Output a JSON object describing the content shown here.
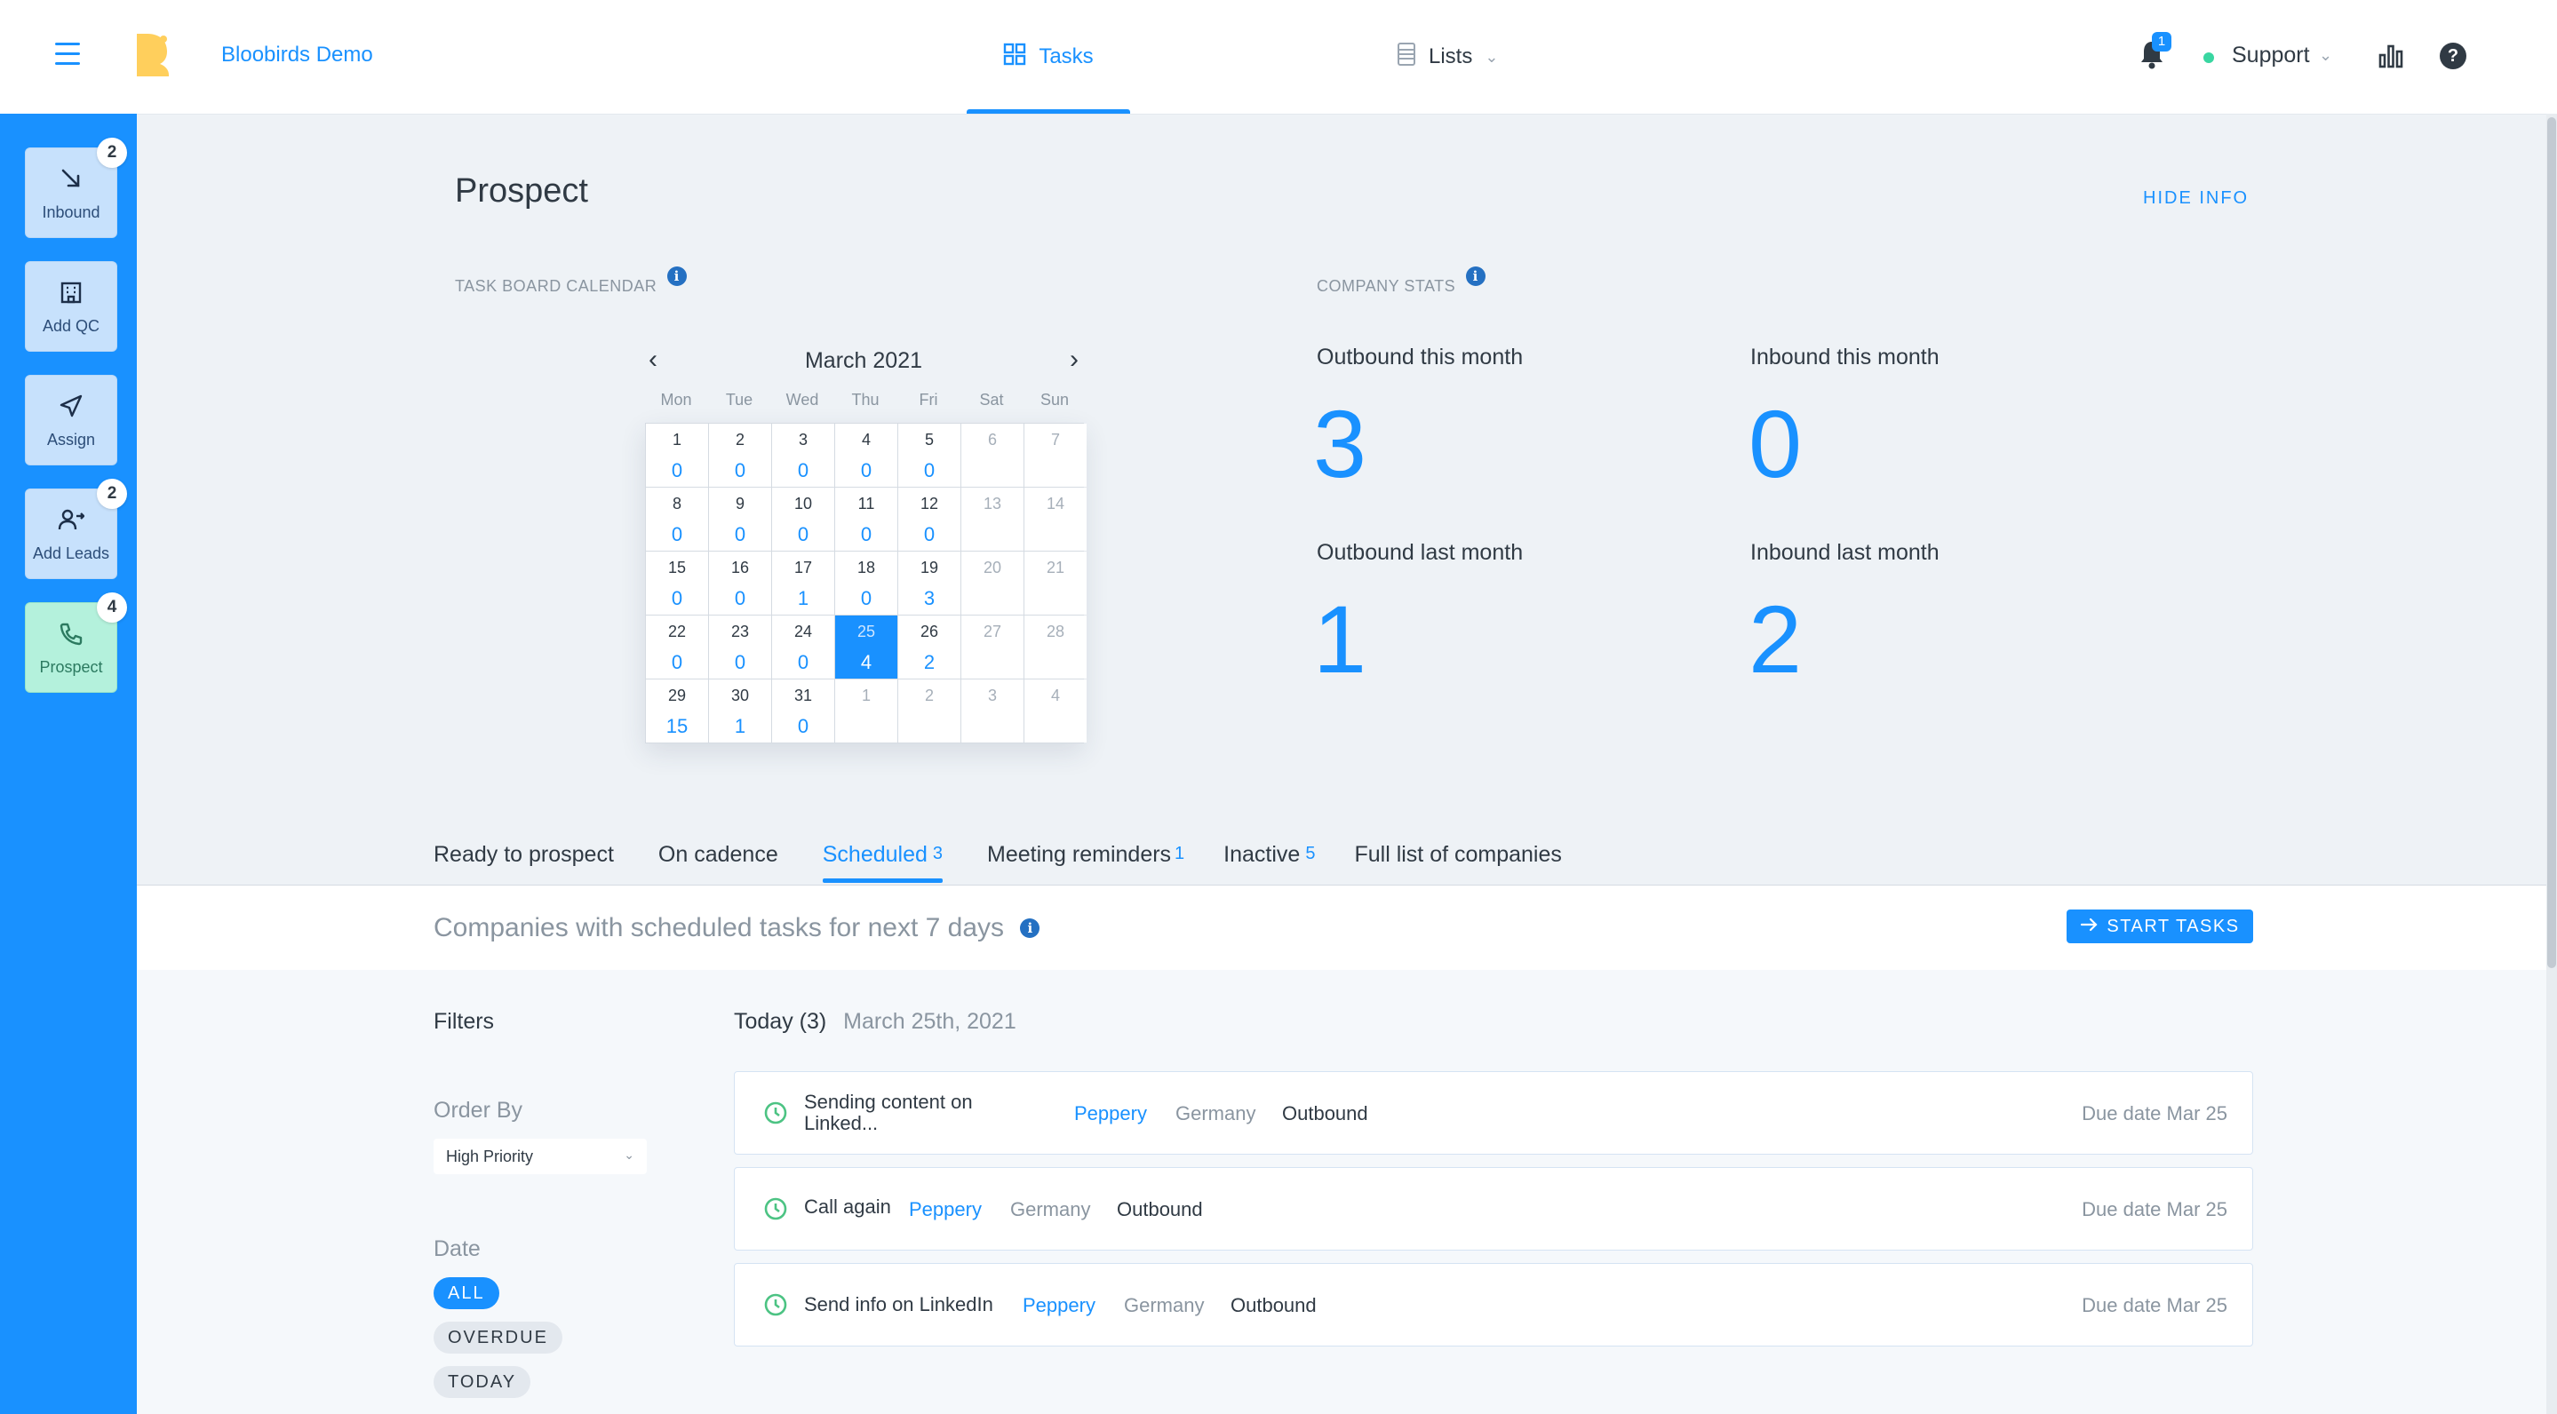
{
  "header": {
    "brand": "Bloobirds Demo",
    "nav": [
      {
        "label": "Tasks",
        "icon": "grid-icon",
        "active": true
      },
      {
        "label": "Lists",
        "icon": "list-icon",
        "active": false
      }
    ],
    "notification_count": "1",
    "user": "Support",
    "accent_color": "#1991ff"
  },
  "sidebar": {
    "items": [
      {
        "label": "Inbound",
        "icon": "arrow-down-right-icon",
        "badge": "2"
      },
      {
        "label": "Add QC",
        "icon": "building-icon",
        "badge": ""
      },
      {
        "label": "Assign",
        "icon": "send-icon",
        "badge": ""
      },
      {
        "label": "Add Leads",
        "icon": "add-user-icon",
        "badge": "2"
      },
      {
        "label": "Prospect",
        "icon": "phone-icon",
        "badge": "4",
        "active": true
      }
    ]
  },
  "page": {
    "title": "Prospect",
    "hide_info": "HIDE INFO"
  },
  "calendar": {
    "label": "TASK BOARD CALENDAR",
    "month": "March 2021",
    "weekdays": [
      "Mon",
      "Tue",
      "Wed",
      "Thu",
      "Fri",
      "Sat",
      "Sun"
    ],
    "weeks": [
      [
        {
          "d": "1",
          "c": "0"
        },
        {
          "d": "2",
          "c": "0"
        },
        {
          "d": "3",
          "c": "0"
        },
        {
          "d": "4",
          "c": "0"
        },
        {
          "d": "5",
          "c": "0"
        },
        {
          "d": "6",
          "c": "",
          "m": true
        },
        {
          "d": "7",
          "c": "",
          "m": true
        }
      ],
      [
        {
          "d": "8",
          "c": "0"
        },
        {
          "d": "9",
          "c": "0"
        },
        {
          "d": "10",
          "c": "0"
        },
        {
          "d": "11",
          "c": "0"
        },
        {
          "d": "12",
          "c": "0"
        },
        {
          "d": "13",
          "c": "",
          "m": true
        },
        {
          "d": "14",
          "c": "",
          "m": true
        }
      ],
      [
        {
          "d": "15",
          "c": "0"
        },
        {
          "d": "16",
          "c": "0"
        },
        {
          "d": "17",
          "c": "1"
        },
        {
          "d": "18",
          "c": "0"
        },
        {
          "d": "19",
          "c": "3"
        },
        {
          "d": "20",
          "c": "",
          "m": true
        },
        {
          "d": "21",
          "c": "",
          "m": true
        }
      ],
      [
        {
          "d": "22",
          "c": "0"
        },
        {
          "d": "23",
          "c": "0"
        },
        {
          "d": "24",
          "c": "0"
        },
        {
          "d": "25",
          "c": "4",
          "today": true
        },
        {
          "d": "26",
          "c": "2"
        },
        {
          "d": "27",
          "c": "",
          "m": true
        },
        {
          "d": "28",
          "c": "",
          "m": true
        }
      ],
      [
        {
          "d": "29",
          "c": "15"
        },
        {
          "d": "30",
          "c": "1"
        },
        {
          "d": "31",
          "c": "0"
        },
        {
          "d": "1",
          "c": "",
          "m": true
        },
        {
          "d": "2",
          "c": "",
          "m": true
        },
        {
          "d": "3",
          "c": "",
          "m": true
        },
        {
          "d": "4",
          "c": "",
          "m": true
        }
      ]
    ]
  },
  "stats": {
    "label": "COMPANY STATS",
    "outbound_this_month": {
      "label": "Outbound this month",
      "value": "3"
    },
    "inbound_this_month": {
      "label": "Inbound this month",
      "value": "0"
    },
    "outbound_last_month": {
      "label": "Outbound last month",
      "value": "1"
    },
    "inbound_last_month": {
      "label": "Inbound last month",
      "value": "2"
    }
  },
  "tabs": [
    {
      "label": "Ready to prospect",
      "count": ""
    },
    {
      "label": "On cadence",
      "count": ""
    },
    {
      "label": "Scheduled",
      "count": "3",
      "active": true
    },
    {
      "label": "Meeting reminders",
      "count": "1"
    },
    {
      "label": "Inactive",
      "count": "5"
    },
    {
      "label": "Full list of companies",
      "count": ""
    }
  ],
  "scheduled": {
    "subtitle": "Companies with scheduled tasks for next 7 days",
    "start_button": "START TASKS"
  },
  "filters": {
    "title": "Filters",
    "order_by_label": "Order By",
    "order_by_value": "High Priority",
    "date_label": "Date",
    "date_chips": [
      "ALL",
      "OVERDUE",
      "TODAY"
    ]
  },
  "tasks": {
    "day": "Today (3)",
    "date": "March 25th, 2021",
    "items": [
      {
        "name": "Sending content on Linked...",
        "company": "Peppery",
        "country": "Germany",
        "type": "Outbound",
        "due": "Due date Mar 25"
      },
      {
        "name": "Call again",
        "company": "Peppery",
        "country": "Germany",
        "type": "Outbound",
        "due": "Due date Mar 25"
      },
      {
        "name": "Send info on LinkedIn",
        "company": "Peppery",
        "country": "Germany",
        "type": "Outbound",
        "due": "Due date Mar 25"
      }
    ]
  }
}
